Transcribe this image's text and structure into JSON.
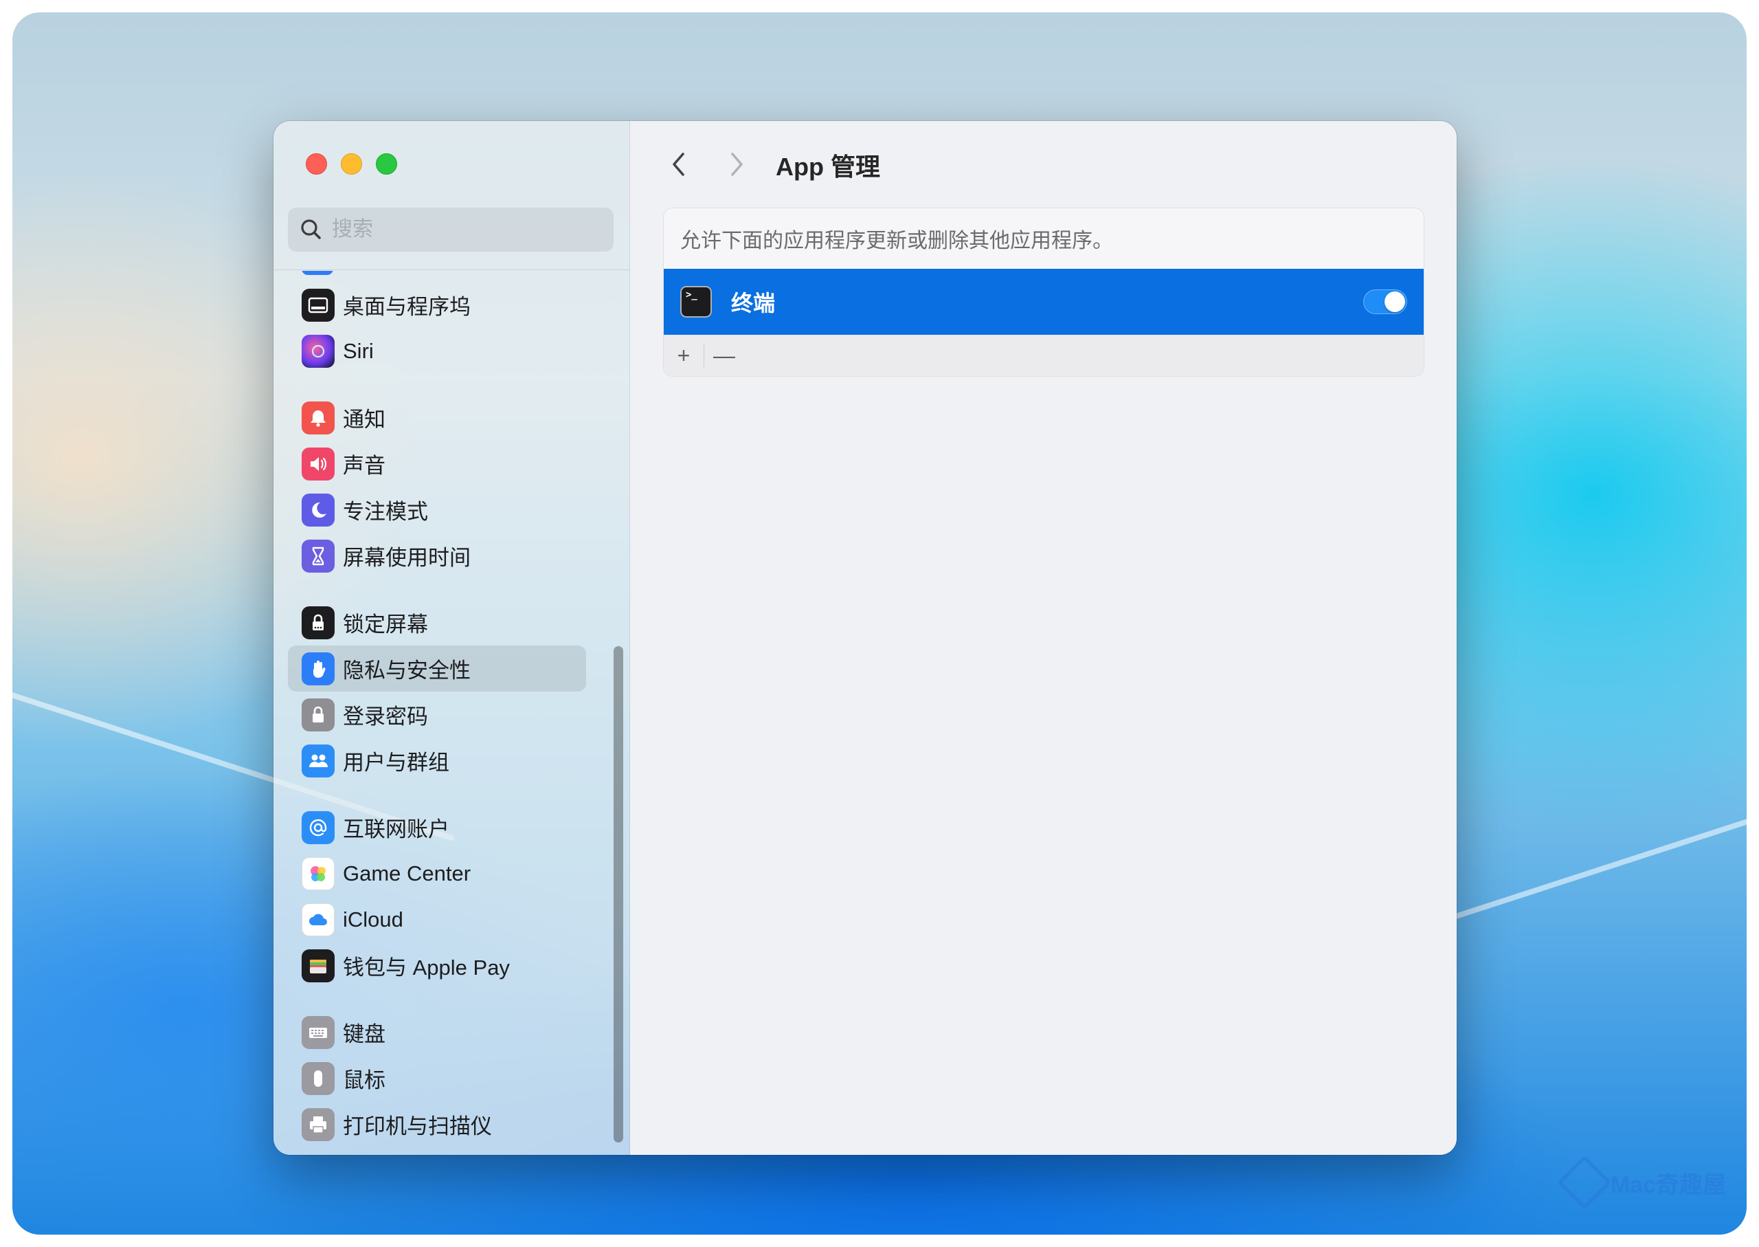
{
  "window": {
    "title": "App 管理",
    "search": {
      "placeholder": "搜索",
      "value": ""
    }
  },
  "sidebar": {
    "groups": [
      [
        {
          "label": "桌面与程序坞",
          "icon": "dock-icon",
          "color": "#1d1d1f"
        },
        {
          "label": "Siri",
          "icon": "siri-icon",
          "color": "#7b3fe4"
        }
      ],
      [
        {
          "label": "通知",
          "icon": "bell-icon",
          "color": "#f2534d"
        },
        {
          "label": "声音",
          "icon": "speaker-icon",
          "color": "#f0466a"
        },
        {
          "label": "专注模式",
          "icon": "moon-icon",
          "color": "#5e5ce6"
        },
        {
          "label": "屏幕使用时间",
          "icon": "hourglass-icon",
          "color": "#6b5ee0"
        }
      ],
      [
        {
          "label": "锁定屏幕",
          "icon": "lock-screen-icon",
          "color": "#1d1d1f"
        },
        {
          "label": "隐私与安全性",
          "icon": "hand-icon",
          "color": "#2b7ef7",
          "selected": true
        },
        {
          "label": "登录密码",
          "icon": "padlock-icon",
          "color": "#8e8e93"
        },
        {
          "label": "用户与群组",
          "icon": "users-icon",
          "color": "#2b8ef7"
        }
      ],
      [
        {
          "label": "互联网账户",
          "icon": "at-icon",
          "color": "#2b8ef7"
        },
        {
          "label": "Game Center",
          "icon": "game-center-icon",
          "color": "#ffffff"
        },
        {
          "label": "iCloud",
          "icon": "cloud-icon",
          "color": "#ffffff"
        },
        {
          "label": "钱包与 Apple Pay",
          "icon": "wallet-icon",
          "color": "#1d1d1f"
        }
      ],
      [
        {
          "label": "键盘",
          "icon": "keyboard-icon",
          "color": "#9a9aa0"
        },
        {
          "label": "鼠标",
          "icon": "mouse-icon",
          "color": "#9a9aa0"
        },
        {
          "label": "打印机与扫描仪",
          "icon": "printer-icon",
          "color": "#9a9aa0"
        }
      ]
    ]
  },
  "main": {
    "description": "允许下面的应用程序更新或删除其他应用程序。",
    "apps": [
      {
        "name": "终端",
        "icon": "terminal-icon",
        "enabled": true
      }
    ],
    "toolbar": {
      "add_label": "+",
      "remove_label": "—"
    }
  },
  "watermark": {
    "text": "Mac奇趣屋"
  },
  "colors": {
    "accent": "#0a6fe1",
    "toggle_on": "#1f8df8"
  }
}
